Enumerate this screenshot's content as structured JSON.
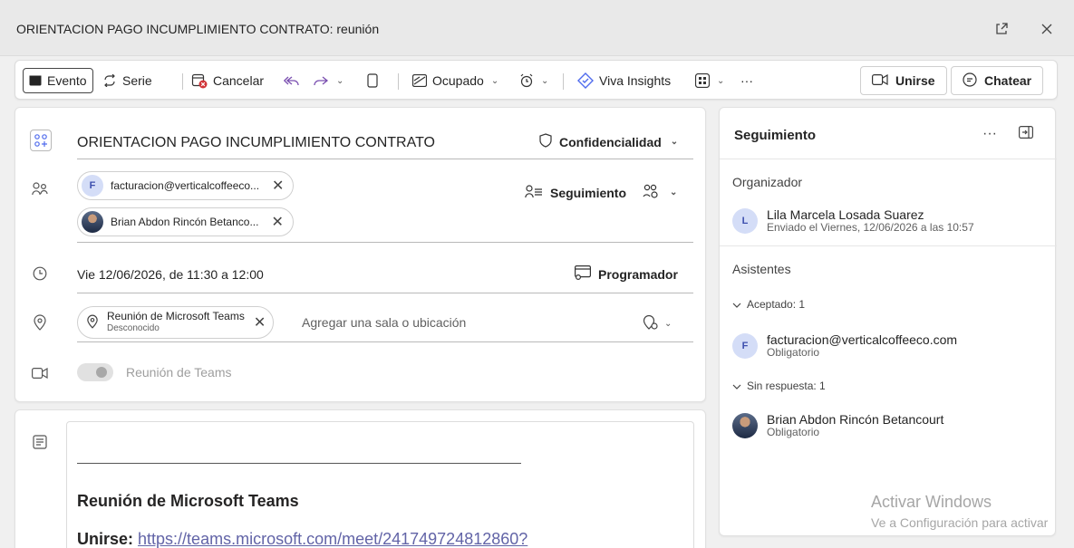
{
  "window": {
    "title": "ORIENTACION PAGO INCUMPLIMIENTO CONTRATO: reunión",
    "popout_icon": "popout-icon",
    "close_icon": "close-icon"
  },
  "toolbar": {
    "evento": "Evento",
    "serie": "Serie",
    "cancelar": "Cancelar",
    "ocupado": "Ocupado",
    "viva": "Viva Insights",
    "more": "···",
    "unirse": "Unirse",
    "chatear": "Chatear"
  },
  "form": {
    "subject": "ORIENTACION PAGO INCUMPLIMIENTO CONTRATO",
    "confidencialidad": "Confidencialidad",
    "attendees": [
      {
        "initial": "F",
        "label": "facturacion@verticalcoffeeco..."
      },
      {
        "initial": "",
        "label": "Brian Abdon Rincón Betanco..."
      }
    ],
    "seguimiento": "Seguimiento",
    "datetime": "Vie 12/06/2026, de 11:30 a 12:00",
    "programador": "Programador",
    "location": {
      "name": "Reunión de Microsoft Teams",
      "status": "Desconocido",
      "placeholder": "Agregar una sala o ubicación"
    },
    "teams_toggle": "Reunión de Teams"
  },
  "body": {
    "heading": "Reunión de Microsoft Teams",
    "join_label": "Unirse:",
    "join_link": "https://teams.microsoft.com/meet/241749724812860?"
  },
  "side": {
    "title": "Seguimiento",
    "more": "···",
    "organizador_label": "Organizador",
    "organizer": {
      "initial": "L",
      "name": "Lila Marcela Losada Suarez",
      "sent": "Enviado el Viernes, 12/06/2026 a las 10:57"
    },
    "asistentes_label": "Asistentes",
    "aceptado": "Aceptado: 1",
    "accepted_person": {
      "initial": "F",
      "name": "facturacion@verticalcoffeeco.com",
      "role": "Obligatorio"
    },
    "sin_respuesta": "Sin respuesta: 1",
    "noresp_person": {
      "name": "Brian Abdon Rincón Betancourt",
      "role": "Obligatorio"
    }
  },
  "watermark": {
    "line1": "Activar Windows",
    "line2": "Ve a Configuración para activar"
  }
}
